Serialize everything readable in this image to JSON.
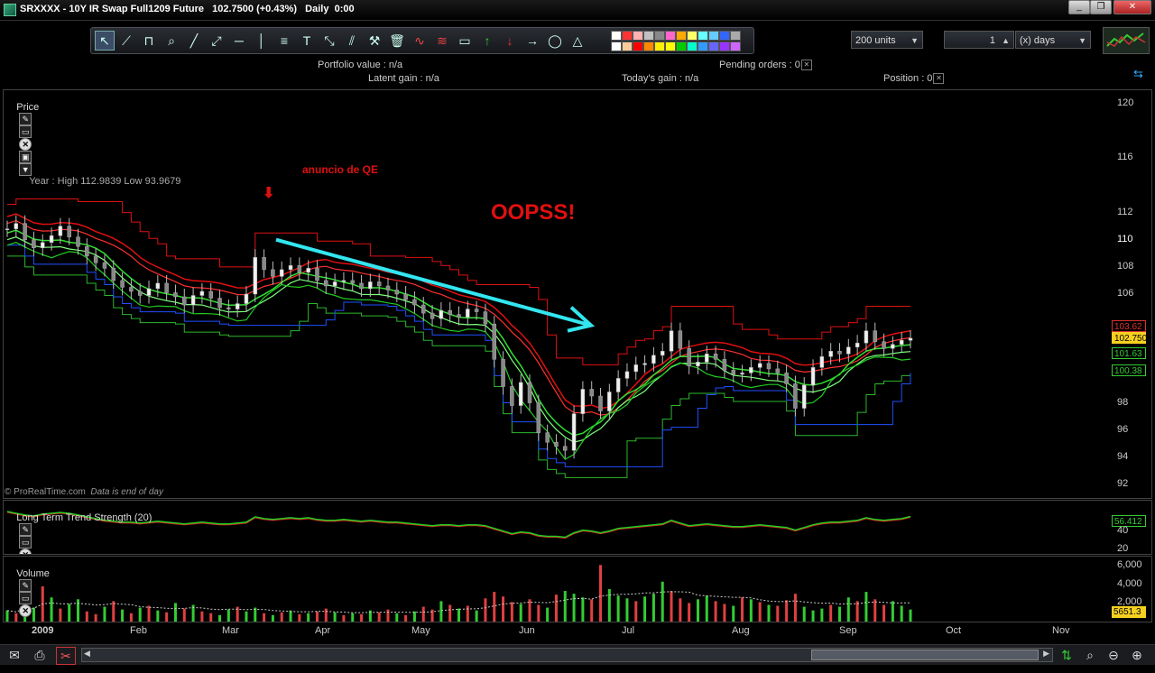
{
  "window": {
    "title": "SRXXXX - 10Y IR Swap Full1209 Future   102.7500 (+0.43%)   Daily  0:00",
    "minimize": "_",
    "restore": "❐",
    "close": "✕"
  },
  "toolbar": {
    "units_value": "200 units",
    "days_value": "1",
    "days_unit": "(x) days",
    "tools": [
      "cursor-icon",
      "ruler-icon",
      "magnet-icon",
      "zoom-icon",
      "line-icon",
      "ray-icon",
      "horizontal-line-icon",
      "vertical-line-icon",
      "fibonacci-icon",
      "text-icon",
      "arrow-tool-icon",
      "channel-icon",
      "wrench-icon",
      "trash-icon",
      "indicator-icon",
      "indicator2-icon",
      "rectangle-icon",
      "green-up-arrow-icon",
      "red-down-arrow-icon",
      "right-arrow-icon",
      "ellipse-icon",
      "triangle-icon"
    ],
    "swatch_colors": [
      "#ffffff",
      "#ff3333",
      "#ffb0b0",
      "#c0c0c0",
      "#888888",
      "#ff66cc",
      "#ffaa00",
      "#ffff66",
      "#66ffff",
      "#66ccff",
      "#3366ff",
      "#aaaaaa",
      "#ffffff",
      "#ffcc99",
      "#ff0000",
      "#ff8800",
      "#ffee00",
      "#ffff00",
      "#00cc00",
      "#00ffcc",
      "#3399ff",
      "#6666ff",
      "#9933ff",
      "#cc66ff"
    ]
  },
  "status": {
    "portfolio": "Portfolio value : n/a",
    "pending": "Pending orders : 0",
    "latent": "Latent gain : n/a",
    "today": "Today's gain : n/a",
    "position": "Position : 0"
  },
  "price_panel": {
    "label": "Price",
    "info": "Year : High 112.9839 Low 93.9679",
    "credit": "© ProRealTime.com",
    "credit_note": "Data is end of day",
    "annotation_qe": "anuncio de QE",
    "annotation_oops": "OOPSS!"
  },
  "lts_panel": {
    "label": "Long Term Trend Strength (20)",
    "value_tag": "56.412"
  },
  "volume_panel": {
    "label": "Volume",
    "value_tag": "5651.3"
  },
  "colors": {
    "up": "#33cc33",
    "down": "#e04040",
    "trend_arrow": "#33e6f0",
    "annotation": "#e01010",
    "price_tag": "#f5d020"
  },
  "chart_data": {
    "type": "line",
    "title": "SRXXXX - 10Y IR Swap Full1209 Future",
    "x_labels": [
      "2009",
      "Feb",
      "Mar",
      "Apr",
      "May",
      "Jun",
      "Jul",
      "Aug",
      "Sep",
      "Oct",
      "Nov"
    ],
    "y_ticks": [
      120,
      116,
      112,
      110,
      108,
      106,
      98,
      96,
      94,
      92
    ],
    "ylim": [
      91,
      121
    ],
    "price_tags": [
      "103.62",
      "102.7500",
      "101.63",
      "100.38"
    ],
    "year_high": 112.9839,
    "year_low": 93.9679,
    "close_values": [
      110.8,
      111.2,
      110.0,
      109.4,
      109.8,
      110.3,
      111.0,
      110.2,
      109.5,
      108.8,
      108.3,
      107.9,
      107.0,
      106.5,
      106.2,
      105.9,
      106.4,
      106.8,
      106.1,
      105.8,
      105.2,
      105.9,
      106.2,
      105.7,
      105.0,
      104.9,
      105.3,
      106.0,
      108.7,
      107.8,
      107.3,
      107.8,
      108.1,
      107.6,
      107.9,
      107.0,
      106.6,
      106.9,
      107.0,
      106.8,
      106.4,
      106.9,
      106.6,
      106.3,
      106.0,
      105.6,
      105.2,
      104.6,
      104.2,
      104.8,
      104.5,
      104.3,
      104.9,
      104.7,
      103.8,
      101.2,
      99.2,
      97.8,
      99.5,
      98.0,
      95.8,
      95.1,
      94.8,
      94.5,
      97.2,
      99.0,
      98.5,
      97.4,
      98.8,
      99.8,
      100.3,
      100.8,
      100.9,
      101.5,
      101.8,
      103.3,
      102.0,
      100.7,
      101.0,
      101.6,
      101.2,
      100.4,
      100.1,
      100.2,
      100.6,
      100.9,
      100.5,
      100.2,
      99.4,
      97.6,
      99.3,
      100.6,
      101.4,
      101.8,
      101.6,
      102.1,
      102.4,
      103.3,
      102.5,
      102.0,
      102.3,
      102.6,
      102.75
    ],
    "trend_arrow": {
      "from": [
        "Mar 10",
        110.0
      ],
      "to": [
        "Jun 20",
        103.7
      ]
    },
    "lts_axis": [
      40,
      20
    ],
    "lts_values": [
      62,
      60,
      58,
      57,
      59,
      60,
      61,
      60,
      58,
      56,
      54,
      52,
      51,
      50,
      50,
      49,
      50,
      51,
      50,
      49,
      48,
      49,
      50,
      49,
      48,
      48,
      49,
      50,
      56,
      54,
      53,
      54,
      55,
      54,
      55,
      53,
      52,
      52,
      53,
      52,
      51,
      52,
      51,
      50,
      50,
      49,
      48,
      47,
      46,
      47,
      47,
      46,
      47,
      47,
      46,
      43,
      40,
      37,
      39,
      38,
      35,
      34,
      34,
      33,
      38,
      41,
      40,
      38,
      40,
      43,
      44,
      45,
      46,
      47,
      48,
      52,
      49,
      46,
      47,
      48,
      47,
      46,
      45,
      45,
      46,
      47,
      46,
      45,
      44,
      41,
      44,
      47,
      49,
      50,
      50,
      51,
      52,
      55,
      53,
      52,
      53,
      54,
      56.4
    ],
    "volume_axis": [
      "6,000",
      "4,000",
      "2,000"
    ],
    "volume_values": [
      1200,
      900,
      2100,
      1500,
      3800,
      2600,
      1400,
      1900,
      2400,
      1100,
      800,
      1600,
      2200,
      1300,
      900,
      1500,
      1700,
      1200,
      1000,
      2000,
      1400,
      1800,
      1100,
      900,
      700,
      1300,
      1600,
      1100,
      1500,
      900,
      700,
      1000,
      1200,
      800,
      900,
      1100,
      1400,
      1000,
      700,
      900,
      800,
      1200,
      1000,
      1300,
      900,
      700,
      1100,
      1600,
      1300,
      2200,
      1800,
      1400,
      1700,
      1200,
      2500,
      3200,
      2700,
      2100,
      1900,
      2400,
      1800,
      1500,
      2900,
      3300,
      3000,
      2600,
      2400,
      6100,
      3500,
      2800,
      2500,
      2200,
      2700,
      3000,
      4300,
      3300,
      2500,
      2000,
      2400,
      2800,
      2200,
      1900,
      1700,
      2600,
      2400,
      2100,
      1800,
      1700,
      2300,
      3000,
      1600,
      1200,
      1400,
      1800,
      1600,
      2600,
      2200,
      3200,
      2400,
      1800,
      2200,
      1700,
      1300
    ],
    "volume_up": [
      1,
      0,
      1,
      1,
      0,
      1,
      0,
      1,
      1,
      0,
      0,
      1,
      0,
      1,
      0,
      1,
      0,
      1,
      0,
      1,
      0,
      1,
      0,
      0,
      1,
      1,
      0,
      1,
      1,
      0,
      1,
      0,
      1,
      0,
      1,
      0,
      0,
      1,
      0,
      1,
      0,
      1,
      0,
      0,
      1,
      0,
      1,
      0,
      0,
      1,
      0,
      1,
      0,
      1,
      0,
      0,
      0,
      0,
      1,
      0,
      0,
      1,
      0,
      1,
      1,
      1,
      0,
      0,
      1,
      1,
      1,
      0,
      1,
      1,
      1,
      0,
      0,
      0,
      1,
      1,
      0,
      0,
      1,
      0,
      1,
      0,
      1,
      0,
      0,
      0,
      1,
      1,
      1,
      0,
      1,
      1,
      0,
      1,
      0,
      0,
      1,
      1,
      1
    ]
  }
}
